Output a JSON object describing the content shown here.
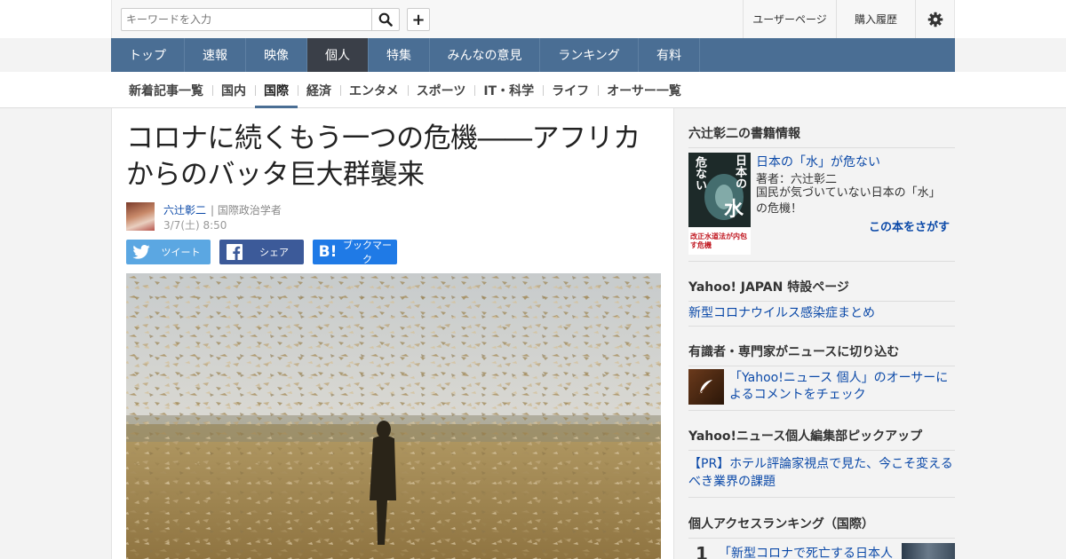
{
  "header": {
    "search_placeholder": "キーワードを入力",
    "plus_label": "+",
    "user_page": "ユーザーページ",
    "purchase_history": "購入履歴"
  },
  "nav": {
    "items": [
      {
        "label": "トップ",
        "width": 83
      },
      {
        "label": "速報",
        "width": 69
      },
      {
        "label": "映像",
        "width": 69
      },
      {
        "label": "個人",
        "width": 69,
        "active": true
      },
      {
        "label": "特集",
        "width": 69
      },
      {
        "label": "みんなの意見",
        "width": 124
      },
      {
        "label": "ランキング",
        "width": 111
      },
      {
        "label": "有料",
        "width": 69
      }
    ]
  },
  "subnav": {
    "items": [
      "新着記事一覧",
      "国内",
      "国際",
      "経済",
      "エンタメ",
      "スポーツ",
      "IT・科学",
      "ライフ",
      "オーサー一覧"
    ],
    "active": "国際"
  },
  "article": {
    "title_line1": "コロナに続くもう一つの危機――アフリカ",
    "title_line2": "からのバッタ巨大群襲来",
    "author_name": "六辻彰二",
    "author_role": "| 国際政治学者",
    "date": "3/7(土) 8:50",
    "share": {
      "twitter": "ツイート",
      "facebook": "シェア",
      "hatena": "ブックマーク"
    }
  },
  "sidebar": {
    "book_section_title": "六辻彰二の書籍情報",
    "book": {
      "title": "日本の「水」が危ない",
      "author": "著者：六辻彰二",
      "description": "国民が気づいていない日本の「水」の危機！",
      "search_link": "この本をさがす",
      "cover_text_top": "日本の",
      "cover_text_mid": "水",
      "cover_text_side": "危ない",
      "cover_text_bottom": "改正水道法が内包す危機"
    },
    "special_title": "Yahoo! JAPAN 特設ページ",
    "special_link": "新型コロナウイルス感染症まとめ",
    "experts_title": "有識者・専門家がニュースに切り込む",
    "experts_link": "「Yahoo!ニュース 個人」のオーサーによるコメントをチェック",
    "pickup_title": "Yahoo!ニュース個人編集部ピックアップ",
    "pickup_link": "【PR】ホテル評論家視点で見た、今こそ変えるべき業界の課題",
    "ranking_title": "個人アクセスランキング（国際）",
    "ranking_1_num": "1",
    "ranking_1_text": "「新型コロナで死亡する日本人"
  }
}
